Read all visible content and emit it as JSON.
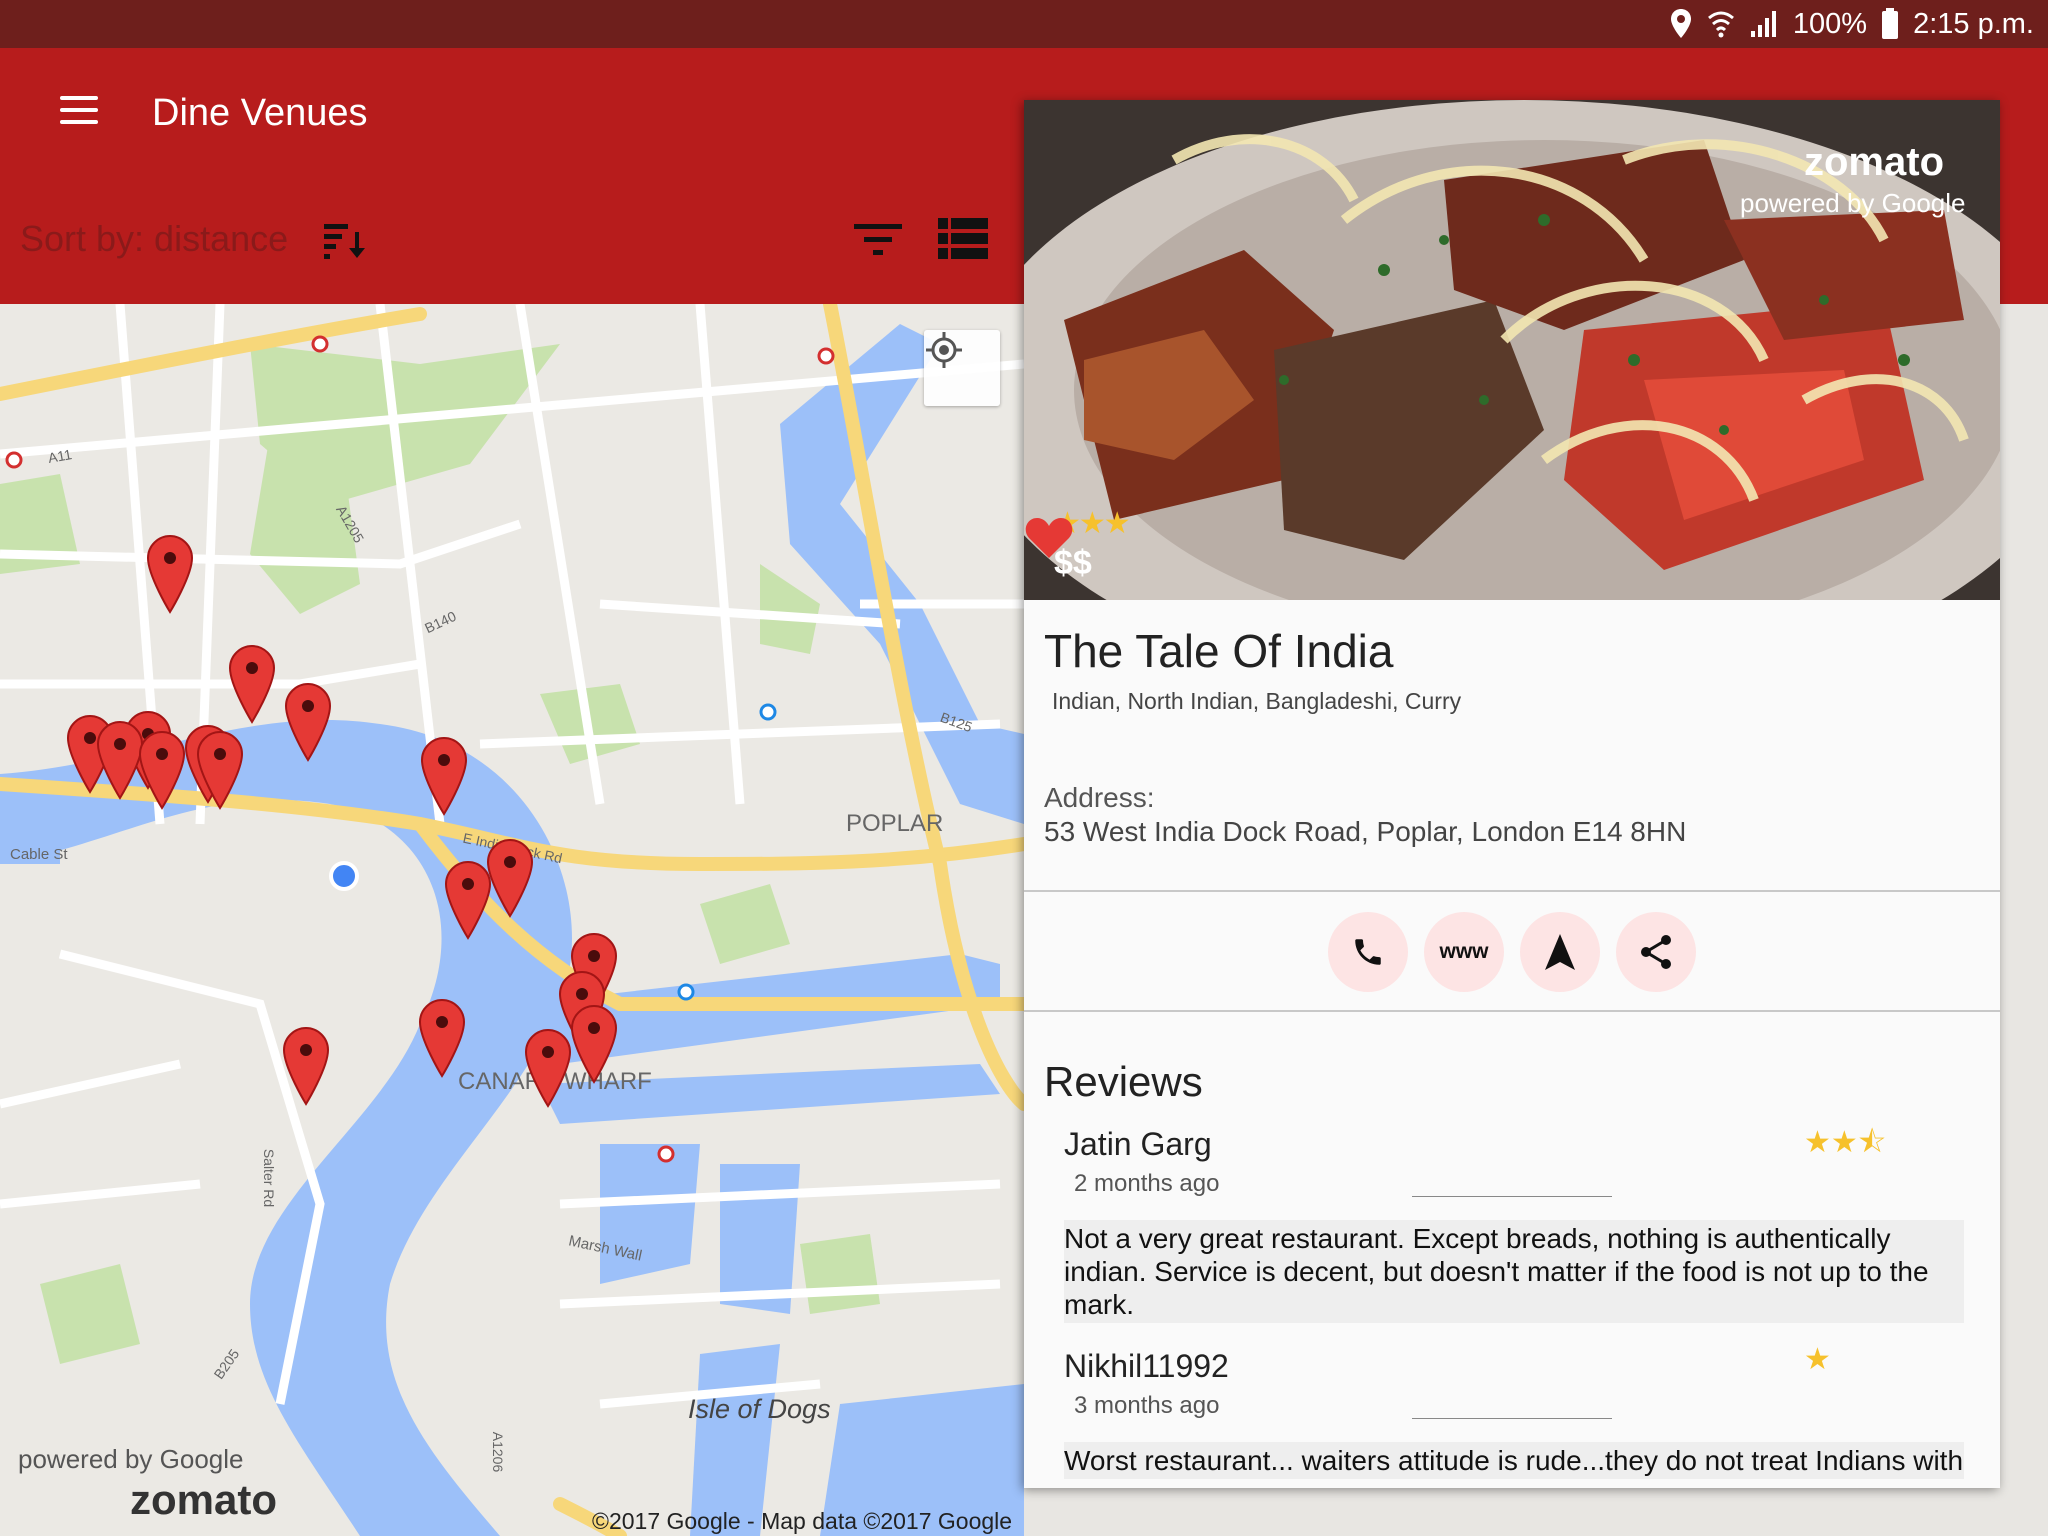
{
  "status_bar": {
    "battery": "100%",
    "time": "2:15 p.m.",
    "icons": [
      "location-icon",
      "wifi-icon",
      "signal-icon",
      "battery-icon"
    ]
  },
  "app_bar": {
    "title": "Dine Venues",
    "sort_label": "Sort by: distance",
    "colors": {
      "primary": "#b71c1c",
      "status": "#6e1f1c"
    }
  },
  "map": {
    "labels": {
      "poplar": "POPLAR",
      "canary": "CANARY WHARF",
      "isle": "Isle of Dogs",
      "cable": "Cable St",
      "a11": "A11",
      "a1205": "A1205",
      "b140": "B140",
      "b125": "B125",
      "eindia": "E India Dock Rd",
      "salter": "Salter Rd",
      "marsh": "Marsh Wall",
      "b205": "B205",
      "a1206": "A1206"
    },
    "copyright": "©2017 Google - Map data ©2017 Google",
    "powered_google": "powered by Google",
    "powered_zomato": "zomato"
  },
  "restaurant": {
    "name": "The Tale Of India",
    "rating_stars": "★★★",
    "price": "$$",
    "cuisines": "Indian, North Indian, Bangladeshi, Curry",
    "address_label": "Address:",
    "address": "53 West India Dock Road, Poplar, London E14 8HN",
    "favorite": true,
    "attribution_zomato": "zomato",
    "attribution_google": "powered by Google",
    "actions": {
      "www": "www"
    }
  },
  "reviews": {
    "title": "Reviews",
    "items": [
      {
        "author": "Jatin Garg",
        "time": "2 months ago",
        "stars": "★★⯪",
        "text": "Not a very great restaurant. Except breads, nothing is authentically indian. Service is decent, but doesn't matter if the food is not up to the mark."
      },
      {
        "author": "Nikhil11992",
        "time": "3 months ago",
        "stars": "★",
        "text": "Worst restaurant... waiters attitude is rude...they do not treat Indians with"
      }
    ]
  }
}
